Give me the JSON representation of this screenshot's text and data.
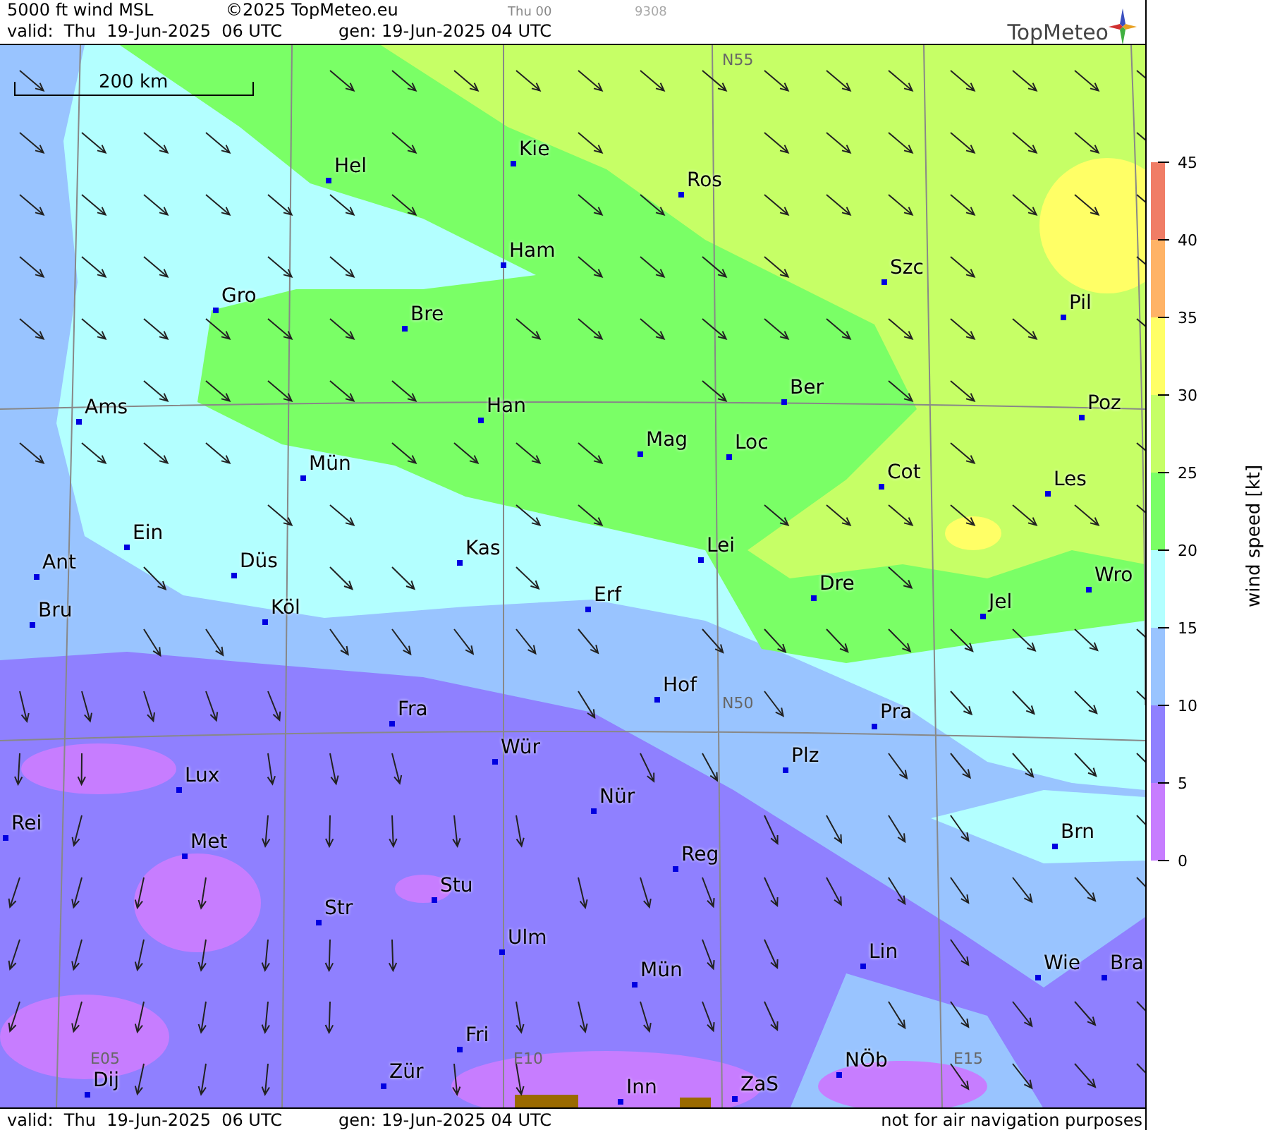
{
  "header": {
    "title": "5000 ft wind MSL",
    "copyright": "©2025 TopMeteo.eu",
    "run": "Thu 00",
    "code": "9308",
    "valid": "valid:  Thu  19-Jun-2025  06 UTC",
    "gen": "gen: 19-Jun-2025 04 UTC",
    "logo": "TopMeteo"
  },
  "map": {
    "scale": "200 km",
    "grid_labels": [
      "N55",
      "N50",
      "E05",
      "E10",
      "E15"
    ],
    "cities": [
      {
        "name": "Hel"
      },
      {
        "name": "Kie"
      },
      {
        "name": "Ros"
      },
      {
        "name": "Ham"
      },
      {
        "name": "Szc"
      },
      {
        "name": "Gro"
      },
      {
        "name": "Bre"
      },
      {
        "name": "Pil"
      },
      {
        "name": "Ber"
      },
      {
        "name": "Ams"
      },
      {
        "name": "Han"
      },
      {
        "name": "Poz"
      },
      {
        "name": "Mag"
      },
      {
        "name": "Loc"
      },
      {
        "name": "Mün"
      },
      {
        "name": "Cot"
      },
      {
        "name": "Les"
      },
      {
        "name": "Ein"
      },
      {
        "name": "Kas"
      },
      {
        "name": "Lei"
      },
      {
        "name": "Ant"
      },
      {
        "name": "Düs"
      },
      {
        "name": "Dre"
      },
      {
        "name": "Wro"
      },
      {
        "name": "Erf"
      },
      {
        "name": "Bru"
      },
      {
        "name": "Köl"
      },
      {
        "name": "Jel"
      },
      {
        "name": "Hof"
      },
      {
        "name": "Fra"
      },
      {
        "name": "Pra"
      },
      {
        "name": "Wür"
      },
      {
        "name": "Plz"
      },
      {
        "name": "Lux"
      },
      {
        "name": "Nür"
      },
      {
        "name": "Rei"
      },
      {
        "name": "Met"
      },
      {
        "name": "Brn"
      },
      {
        "name": "Reg"
      },
      {
        "name": "Stu"
      },
      {
        "name": "Str"
      },
      {
        "name": "Ulm"
      },
      {
        "name": "Lin"
      },
      {
        "name": "Wie"
      },
      {
        "name": "Bra"
      },
      {
        "name": "Mün"
      },
      {
        "name": "Fri"
      },
      {
        "name": "Dij"
      },
      {
        "name": "Zür"
      },
      {
        "name": "Inn"
      },
      {
        "name": "ZaS"
      },
      {
        "name": "NÖb"
      }
    ]
  },
  "legend": {
    "title": "wind speed [kt]",
    "ticks": [
      "45",
      "40",
      "35",
      "30",
      "25",
      "20",
      "15",
      "10",
      "5",
      "0"
    ],
    "bands": [
      {
        "color": "#f07d66"
      },
      {
        "color": "#ffb366"
      },
      {
        "color": "#ffff66"
      },
      {
        "color": "#c6ff66"
      },
      {
        "color": "#7aff66"
      },
      {
        "color": "#b3ffff"
      },
      {
        "color": "#99c4ff"
      },
      {
        "color": "#8f80ff"
      },
      {
        "color": "#c77dff"
      }
    ]
  },
  "footer": {
    "valid": "valid:  Thu  19-Jun-2025  06 UTC",
    "gen": "gen: 19-Jun-2025 04 UTC",
    "note": "not for air navigation purposes"
  }
}
